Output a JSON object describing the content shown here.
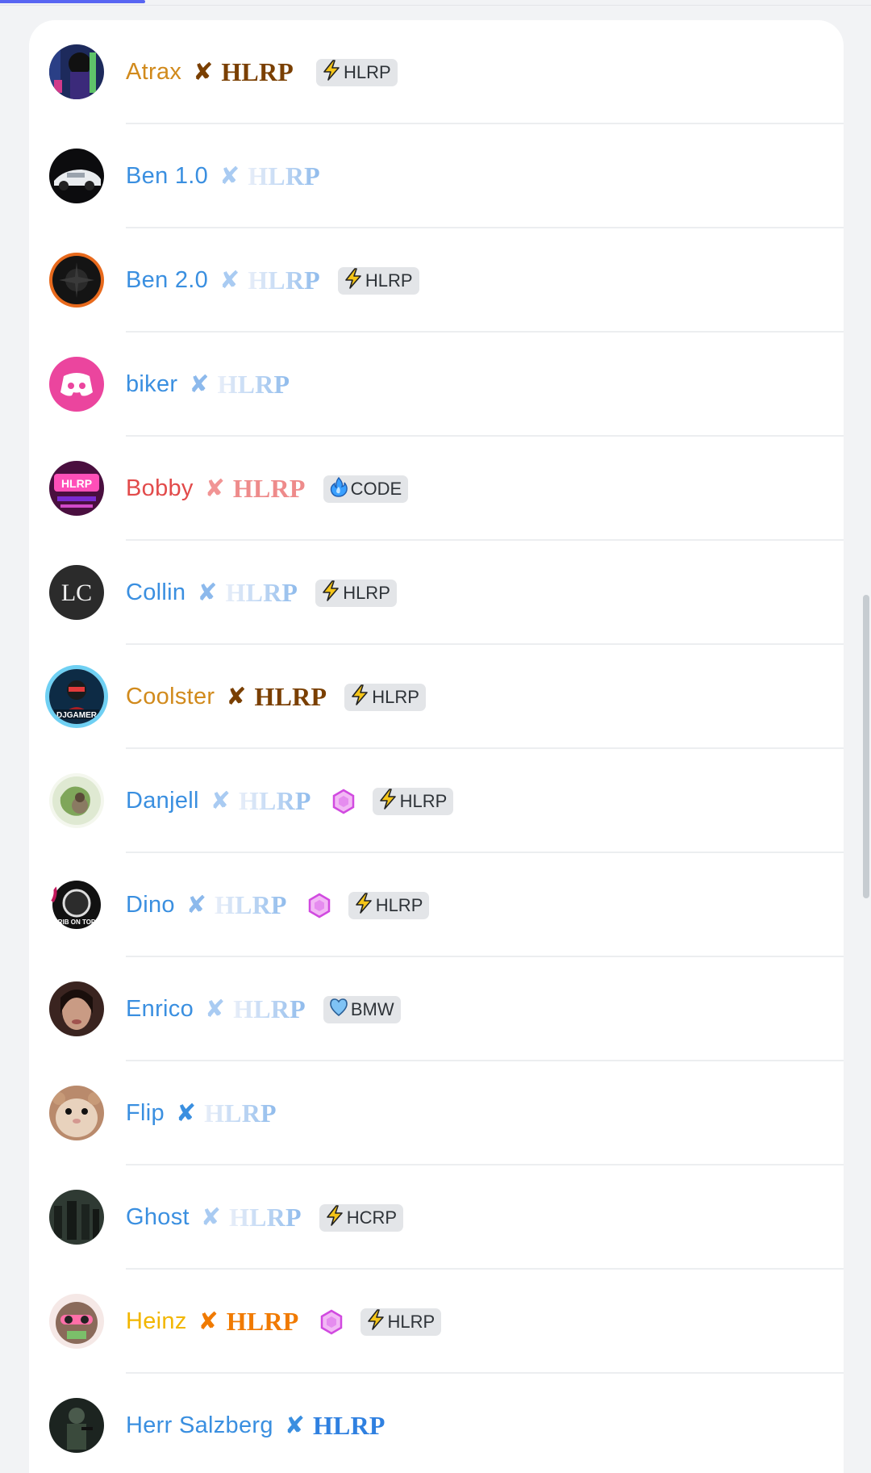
{
  "members": [
    {
      "name": "Atrax",
      "name_color": "#d18a1c",
      "cross_color": "#7a3f00",
      "tag": "HLRP",
      "tag_style": "gold",
      "gem": false,
      "pill": {
        "icon": "bolt-icon",
        "label": "HLRP"
      }
    },
    {
      "name": "Ben 1.0",
      "name_color": "#3a8fe0",
      "cross_color": "#a9cbf2",
      "tag": "HLRP",
      "tag_style": "faded",
      "gem": false,
      "pill": null
    },
    {
      "name": "Ben 2.0",
      "name_color": "#3a8fe0",
      "cross_color": "#a9cbf2",
      "tag": "HLRP",
      "tag_style": "faded",
      "gem": false,
      "pill": {
        "icon": "bolt-icon",
        "label": "HLRP"
      }
    },
    {
      "name": "biker",
      "name_color": "#3a8fe0",
      "cross_color": "#8cb9ec",
      "tag": "HLRP",
      "tag_style": "faded",
      "gem": false,
      "pill": null
    },
    {
      "name": "Bobby",
      "name_color": "#e24b4b",
      "cross_color": "#f19494",
      "tag": "HLRP",
      "tag_style": "red",
      "gem": false,
      "pill": {
        "icon": "fire-icon",
        "label": "CODE"
      }
    },
    {
      "name": "Collin",
      "name_color": "#3a8fe0",
      "cross_color": "#8cb9ec",
      "tag": "HLRP",
      "tag_style": "faded",
      "gem": false,
      "pill": {
        "icon": "bolt-icon",
        "label": "HLRP"
      }
    },
    {
      "name": "Coolster",
      "name_color": "#d18a1c",
      "cross_color": "#7a3f00",
      "tag": "HLRP",
      "tag_style": "gold",
      "gem": false,
      "pill": {
        "icon": "bolt-icon",
        "label": "HLRP"
      }
    },
    {
      "name": "Danjell",
      "name_color": "#3a8fe0",
      "cross_color": "#a9cbf2",
      "tag": "HLRP",
      "tag_style": "faded",
      "gem": true,
      "pill": {
        "icon": "bolt-icon",
        "label": "HLRP"
      }
    },
    {
      "name": "Dino",
      "name_color": "#3a8fe0",
      "cross_color": "#8cb9ec",
      "tag": "HLRP",
      "tag_style": "faded",
      "gem": true,
      "pill": {
        "icon": "bolt-icon",
        "label": "HLRP"
      }
    },
    {
      "name": "Enrico",
      "name_color": "#3a8fe0",
      "cross_color": "#a9cbf2",
      "tag": "HLRP",
      "tag_style": "faded",
      "gem": false,
      "pill": {
        "icon": "heart-icon",
        "label": "BMW"
      }
    },
    {
      "name": "Flip",
      "name_color": "#3a8fe0",
      "cross_color": "#3a8fe0",
      "tag": "HLRP",
      "tag_style": "faded",
      "gem": false,
      "pill": null
    },
    {
      "name": "Ghost",
      "name_color": "#3a8fe0",
      "cross_color": "#a9cbf2",
      "tag": "HLRP",
      "tag_style": "faded",
      "gem": false,
      "pill": {
        "icon": "bolt-icon",
        "label": "HCRP"
      }
    },
    {
      "name": "Heinz",
      "name_color": "#f2b600",
      "cross_color": "#f07a00",
      "tag": "HLRP",
      "tag_style": "orange",
      "gem": true,
      "pill": {
        "icon": "bolt-icon",
        "label": "HLRP"
      }
    },
    {
      "name": "Herr Salzberg",
      "name_color": "#3a8fe0",
      "cross_color": "#3a8fe0",
      "tag": "HLRP",
      "tag_style": "blue",
      "gem": false,
      "pill": null
    }
  ]
}
